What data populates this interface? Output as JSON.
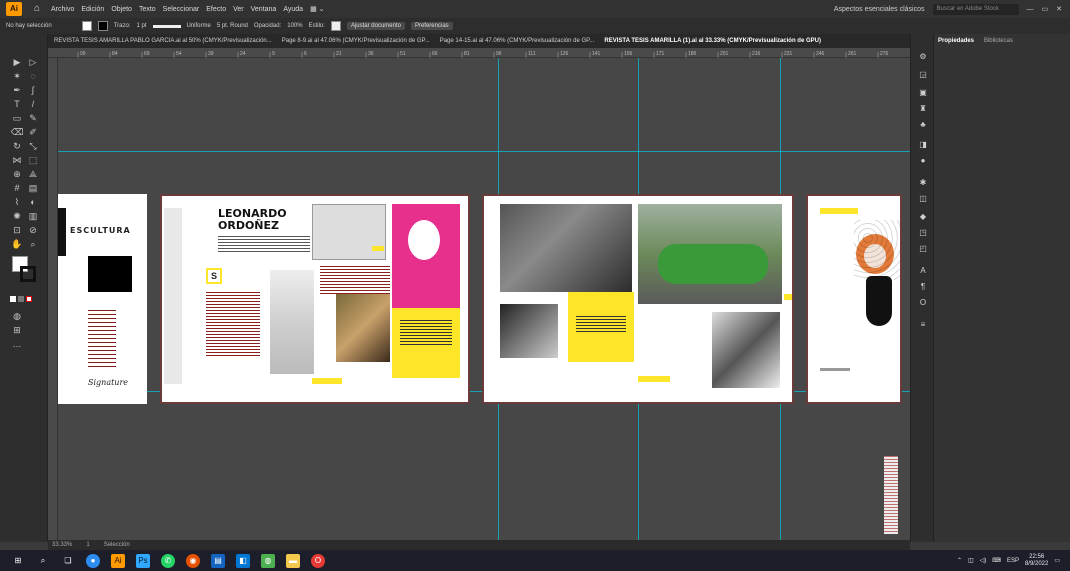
{
  "app": {
    "logo": "Ai",
    "menu": [
      "Archivo",
      "Edición",
      "Objeto",
      "Texto",
      "Seleccionar",
      "Efecto",
      "Ver",
      "Ventana",
      "Ayuda"
    ],
    "workspace": "Aspectos esenciales clásicos",
    "search_placeholder": "Buscar en Adobe Stock"
  },
  "control_bar": {
    "selection": "No hay selección",
    "stroke_label": "Trazo:",
    "stroke_value": "1 pt",
    "profile": "Uniforme",
    "brush": "5 pt. Round",
    "opacity_label": "Opacidad:",
    "opacity_value": "100%",
    "style_label": "Estilo:",
    "fit_button": "Ajustar documento",
    "prefs_button": "Preferencias"
  },
  "tabs": [
    {
      "label": "REVISTA TESIS AMARILLA PABLO GARCIA.ai al 50% (CMYK/Previsualización...",
      "active": false
    },
    {
      "label": "Page 8-9.ai al 47.06% (CMYK/Previsualización de GP...",
      "active": false
    },
    {
      "label": "Page 14-15.ai al 47.06% (CMYK/Previsualización de GP...",
      "active": false
    },
    {
      "label": "REVISTA TESIS AMARILLA (1).ai al 33.33% (CMYK/Previsualización de GPU)",
      "active": true
    }
  ],
  "ruler_ticks": [
    "99",
    "84",
    "69",
    "54",
    "39",
    "24",
    "9",
    "6",
    "21",
    "36",
    "51",
    "66",
    "81",
    "96",
    "111",
    "126",
    "141",
    "156",
    "171",
    "186",
    "201",
    "216",
    "231",
    "246",
    "261",
    "276"
  ],
  "panel": {
    "tab_properties": "Propiedades",
    "tab_libraries": "Bibliotecas"
  },
  "artboard": {
    "escultura": "ESCULTURA",
    "title_line1": "LEONARDO",
    "title_line2": "ORDOÑEZ",
    "dropcap": "S",
    "signature": "Signature"
  },
  "status": {
    "zoom": "33.33%",
    "artboard_num": "1",
    "tool": "Selección"
  },
  "taskbar": {
    "lang": "ESP",
    "time": "22:56",
    "date": "8/9/2022"
  },
  "colors": {
    "accent_yellow": "#fde62a",
    "guide": "#00c8e0",
    "magenta": "#e6308c"
  }
}
